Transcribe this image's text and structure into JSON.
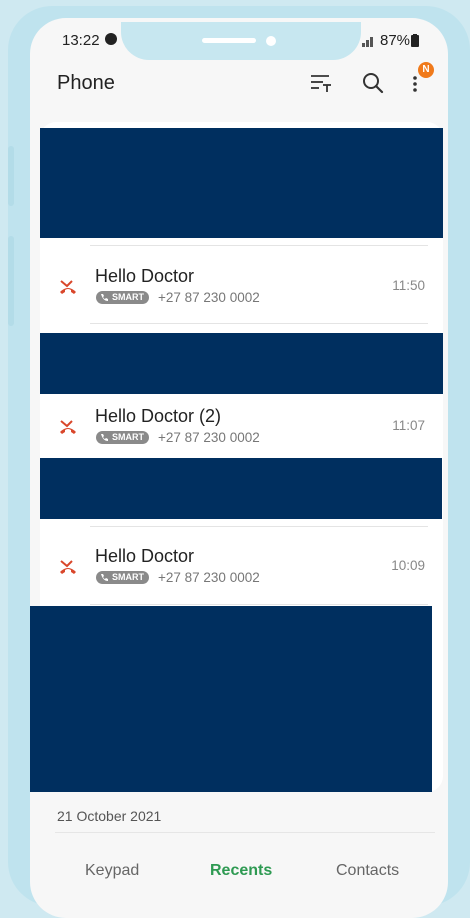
{
  "status_bar": {
    "time": "13:22",
    "battery": "87%"
  },
  "header": {
    "title": "Phone",
    "notification_badge": "N"
  },
  "calls": [
    {
      "name": "Hello Doctor",
      "tag": "SMART",
      "number": "+27 87 230 0002",
      "time": "11:50"
    },
    {
      "name": "Hello Doctor (2)",
      "tag": "SMART",
      "number": "+27 87 230 0002",
      "time": "11:07"
    },
    {
      "name": "Hello Doctor",
      "tag": "SMART",
      "number": "+27 87 230 0002",
      "time": "10:09"
    }
  ],
  "date_header": "21 October 2021",
  "tabs": [
    {
      "label": "Keypad",
      "active": false
    },
    {
      "label": "Recents",
      "active": true
    },
    {
      "label": "Contacts",
      "active": false
    }
  ],
  "colors": {
    "redaction": "#002f5f",
    "missed_call": "#d9472b",
    "active_tab": "#2e9a52",
    "badge": "#f07a1b"
  },
  "icons": [
    "vibrate-icon",
    "signal-icon",
    "battery-icon",
    "filter-icon",
    "search-icon",
    "more-vert-icon",
    "missed-call-icon",
    "phone-icon"
  ]
}
